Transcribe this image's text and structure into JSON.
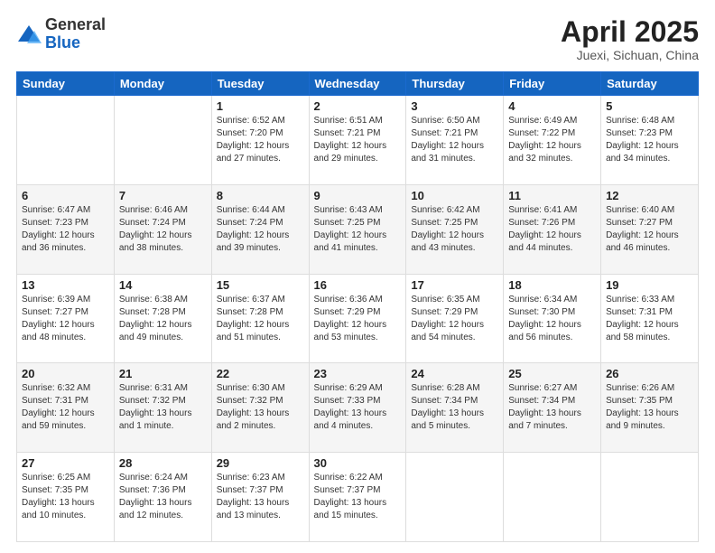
{
  "header": {
    "logo_general": "General",
    "logo_blue": "Blue",
    "month_title": "April 2025",
    "location": "Juexi, Sichuan, China"
  },
  "days_of_week": [
    "Sunday",
    "Monday",
    "Tuesday",
    "Wednesday",
    "Thursday",
    "Friday",
    "Saturday"
  ],
  "weeks": [
    [
      {
        "day": "",
        "info": ""
      },
      {
        "day": "",
        "info": ""
      },
      {
        "day": "1",
        "info": "Sunrise: 6:52 AM\nSunset: 7:20 PM\nDaylight: 12 hours and 27 minutes."
      },
      {
        "day": "2",
        "info": "Sunrise: 6:51 AM\nSunset: 7:21 PM\nDaylight: 12 hours and 29 minutes."
      },
      {
        "day": "3",
        "info": "Sunrise: 6:50 AM\nSunset: 7:21 PM\nDaylight: 12 hours and 31 minutes."
      },
      {
        "day": "4",
        "info": "Sunrise: 6:49 AM\nSunset: 7:22 PM\nDaylight: 12 hours and 32 minutes."
      },
      {
        "day": "5",
        "info": "Sunrise: 6:48 AM\nSunset: 7:23 PM\nDaylight: 12 hours and 34 minutes."
      }
    ],
    [
      {
        "day": "6",
        "info": "Sunrise: 6:47 AM\nSunset: 7:23 PM\nDaylight: 12 hours and 36 minutes."
      },
      {
        "day": "7",
        "info": "Sunrise: 6:46 AM\nSunset: 7:24 PM\nDaylight: 12 hours and 38 minutes."
      },
      {
        "day": "8",
        "info": "Sunrise: 6:44 AM\nSunset: 7:24 PM\nDaylight: 12 hours and 39 minutes."
      },
      {
        "day": "9",
        "info": "Sunrise: 6:43 AM\nSunset: 7:25 PM\nDaylight: 12 hours and 41 minutes."
      },
      {
        "day": "10",
        "info": "Sunrise: 6:42 AM\nSunset: 7:25 PM\nDaylight: 12 hours and 43 minutes."
      },
      {
        "day": "11",
        "info": "Sunrise: 6:41 AM\nSunset: 7:26 PM\nDaylight: 12 hours and 44 minutes."
      },
      {
        "day": "12",
        "info": "Sunrise: 6:40 AM\nSunset: 7:27 PM\nDaylight: 12 hours and 46 minutes."
      }
    ],
    [
      {
        "day": "13",
        "info": "Sunrise: 6:39 AM\nSunset: 7:27 PM\nDaylight: 12 hours and 48 minutes."
      },
      {
        "day": "14",
        "info": "Sunrise: 6:38 AM\nSunset: 7:28 PM\nDaylight: 12 hours and 49 minutes."
      },
      {
        "day": "15",
        "info": "Sunrise: 6:37 AM\nSunset: 7:28 PM\nDaylight: 12 hours and 51 minutes."
      },
      {
        "day": "16",
        "info": "Sunrise: 6:36 AM\nSunset: 7:29 PM\nDaylight: 12 hours and 53 minutes."
      },
      {
        "day": "17",
        "info": "Sunrise: 6:35 AM\nSunset: 7:29 PM\nDaylight: 12 hours and 54 minutes."
      },
      {
        "day": "18",
        "info": "Sunrise: 6:34 AM\nSunset: 7:30 PM\nDaylight: 12 hours and 56 minutes."
      },
      {
        "day": "19",
        "info": "Sunrise: 6:33 AM\nSunset: 7:31 PM\nDaylight: 12 hours and 58 minutes."
      }
    ],
    [
      {
        "day": "20",
        "info": "Sunrise: 6:32 AM\nSunset: 7:31 PM\nDaylight: 12 hours and 59 minutes."
      },
      {
        "day": "21",
        "info": "Sunrise: 6:31 AM\nSunset: 7:32 PM\nDaylight: 13 hours and 1 minute."
      },
      {
        "day": "22",
        "info": "Sunrise: 6:30 AM\nSunset: 7:32 PM\nDaylight: 13 hours and 2 minutes."
      },
      {
        "day": "23",
        "info": "Sunrise: 6:29 AM\nSunset: 7:33 PM\nDaylight: 13 hours and 4 minutes."
      },
      {
        "day": "24",
        "info": "Sunrise: 6:28 AM\nSunset: 7:34 PM\nDaylight: 13 hours and 5 minutes."
      },
      {
        "day": "25",
        "info": "Sunrise: 6:27 AM\nSunset: 7:34 PM\nDaylight: 13 hours and 7 minutes."
      },
      {
        "day": "26",
        "info": "Sunrise: 6:26 AM\nSunset: 7:35 PM\nDaylight: 13 hours and 9 minutes."
      }
    ],
    [
      {
        "day": "27",
        "info": "Sunrise: 6:25 AM\nSunset: 7:35 PM\nDaylight: 13 hours and 10 minutes."
      },
      {
        "day": "28",
        "info": "Sunrise: 6:24 AM\nSunset: 7:36 PM\nDaylight: 13 hours and 12 minutes."
      },
      {
        "day": "29",
        "info": "Sunrise: 6:23 AM\nSunset: 7:37 PM\nDaylight: 13 hours and 13 minutes."
      },
      {
        "day": "30",
        "info": "Sunrise: 6:22 AM\nSunset: 7:37 PM\nDaylight: 13 hours and 15 minutes."
      },
      {
        "day": "",
        "info": ""
      },
      {
        "day": "",
        "info": ""
      },
      {
        "day": "",
        "info": ""
      }
    ]
  ]
}
